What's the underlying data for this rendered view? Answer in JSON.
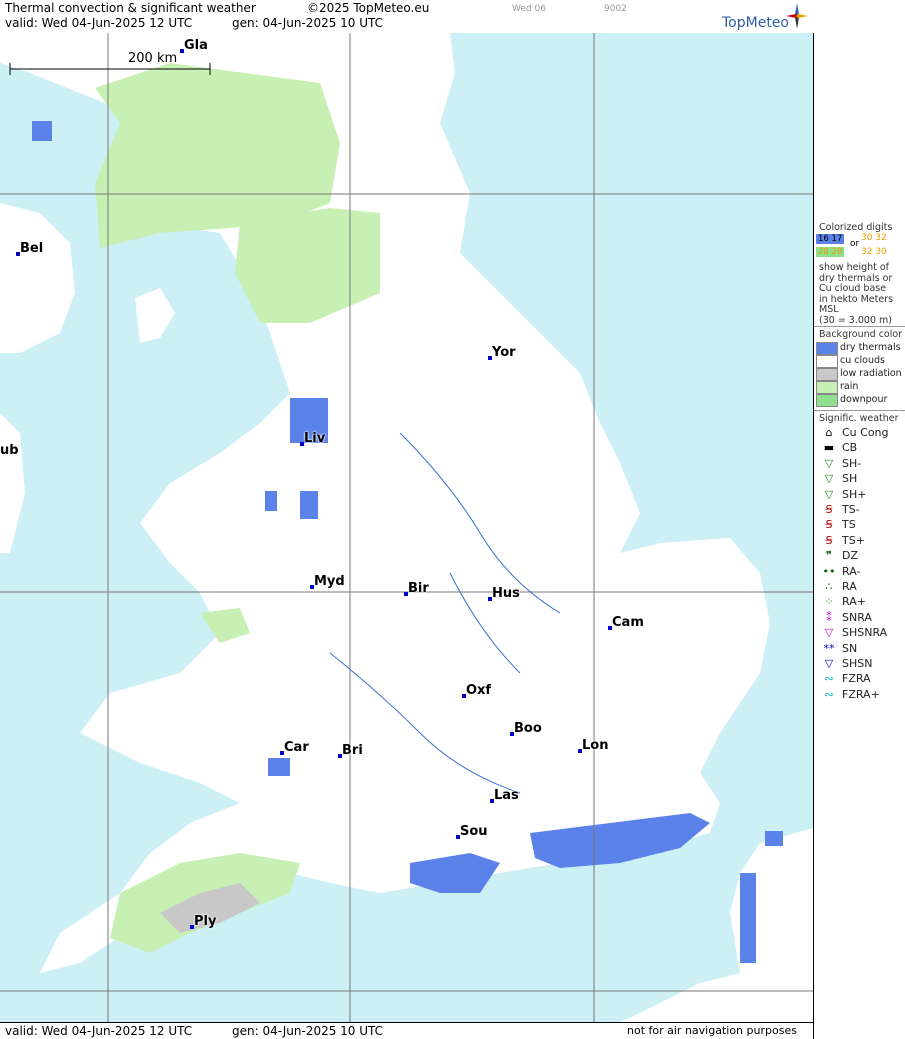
{
  "header": {
    "title": "Thermal convection & significant weather",
    "copyright": "©2025 TopMeteo.eu",
    "valid": "valid:  Wed  04-Jun-2025  12 UTC",
    "gen": "gen: 04-Jun-2025 10 UTC",
    "day_tab": "Wed 06",
    "code": "9002",
    "logo": "TopMeteo"
  },
  "footer": {
    "valid": "valid:  Wed  04-Jun-2025  12 UTC",
    "gen": "gen: 04-Jun-2025 10 UTC",
    "disclaimer": "not for air navigation purposes"
  },
  "map": {
    "scale_label": "200 km",
    "cities": [
      {
        "name": "Gla"
      },
      {
        "name": "Bel"
      },
      {
        "name": "Yor"
      },
      {
        "name": "Liv"
      },
      {
        "name": "ub"
      },
      {
        "name": "Myd"
      },
      {
        "name": "Bir"
      },
      {
        "name": "Hus"
      },
      {
        "name": "Cam"
      },
      {
        "name": "Oxf"
      },
      {
        "name": "Boo"
      },
      {
        "name": "Lon"
      },
      {
        "name": "Car"
      },
      {
        "name": "Bri"
      },
      {
        "name": "Las"
      },
      {
        "name": "Sou"
      },
      {
        "name": "Ply"
      }
    ]
  },
  "legend": {
    "colorized_title": "Colorized digits",
    "digits_a": "16 17",
    "digits_b": "28 28",
    "or": "or",
    "digits_c": "30 32",
    "digits_d": "32 30",
    "desc": [
      "show height of",
      "dry thermals or",
      "Cu cloud base",
      "in hekto Meters",
      "MSL",
      "(30 = 3.000 m)"
    ],
    "bg_title": "Background color",
    "bg_items": [
      {
        "label": "dry thermals",
        "color": "#5a82e8"
      },
      {
        "label": "cu clouds",
        "color": "#ffffff"
      },
      {
        "label": "low radiation",
        "color": "#c8c8c8"
      },
      {
        "label": "rain",
        "color": "#c8f0b4"
      },
      {
        "label": "downpour",
        "color": "#8ee08e"
      }
    ],
    "wx_title": "Signific. weather",
    "wx_items": [
      {
        "label": "Cu Cong",
        "glyph": "⌂",
        "color": "#000000"
      },
      {
        "label": "CB",
        "glyph": "▬",
        "color": "#000000"
      },
      {
        "label": "SH-",
        "glyph": "▽",
        "color": "#228b22"
      },
      {
        "label": "SH",
        "glyph": "▽",
        "color": "#228b22"
      },
      {
        "label": "SH+",
        "glyph": "▽",
        "color": "#228b22"
      },
      {
        "label": "TS-",
        "glyph": "Ꞩ",
        "color": "#c00000"
      },
      {
        "label": "TS",
        "glyph": "Ꞩ",
        "color": "#c00000"
      },
      {
        "label": "TS+",
        "glyph": "Ꞩ",
        "color": "#c00000"
      },
      {
        "label": "DZ",
        "glyph": "❞",
        "color": "#006400"
      },
      {
        "label": "RA-",
        "glyph": "••",
        "color": "#006400"
      },
      {
        "label": "RA",
        "glyph": "∴",
        "color": "#006400"
      },
      {
        "label": "RA+",
        "glyph": "⁘",
        "color": "#006400"
      },
      {
        "label": "SNRA",
        "glyph": "⁑",
        "color": "#cc00cc"
      },
      {
        "label": "SHSNRA",
        "glyph": "▽",
        "color": "#cc00cc"
      },
      {
        "label": "SN",
        "glyph": "**",
        "color": "#0000cc"
      },
      {
        "label": "SHSN",
        "glyph": "▽",
        "color": "#0000cc"
      },
      {
        "label": "FZRA",
        "glyph": "∾",
        "color": "#00b0d0"
      },
      {
        "label": "FZRA+",
        "glyph": "∾",
        "color": "#00b0d0"
      }
    ]
  }
}
